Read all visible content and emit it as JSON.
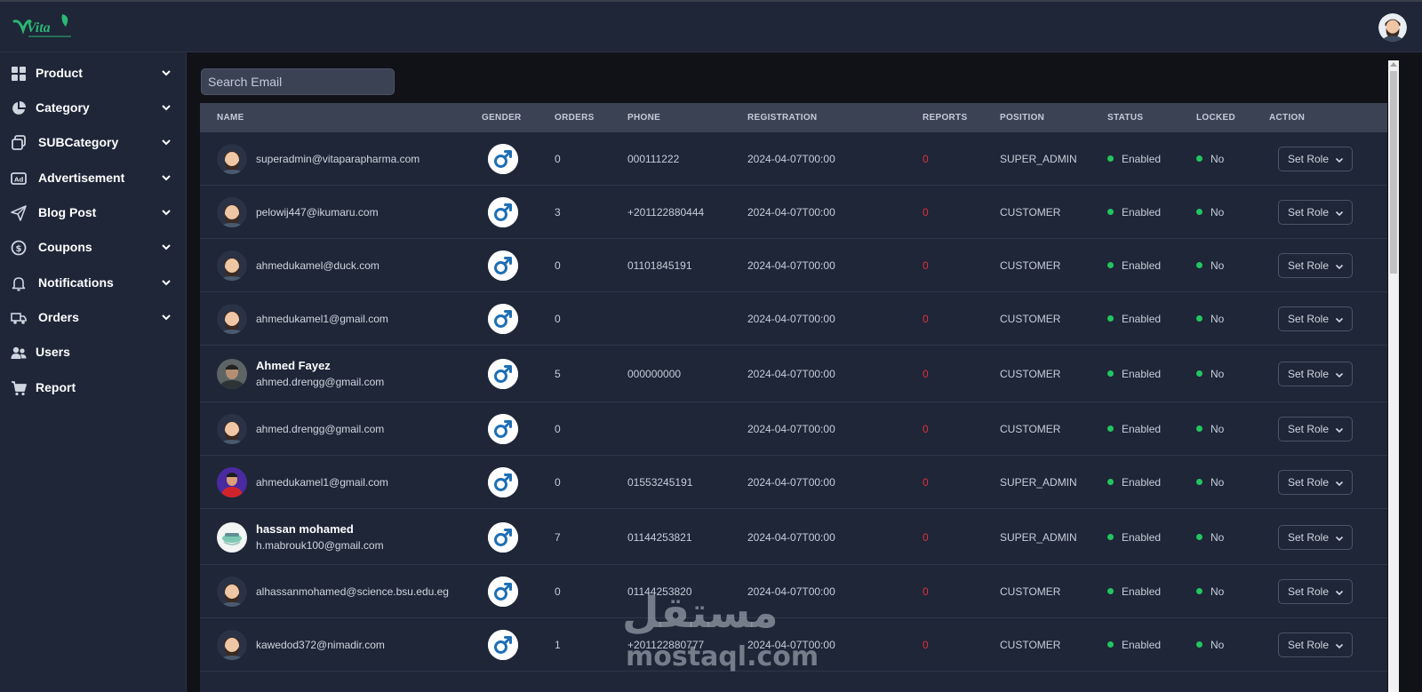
{
  "app": {
    "logo_text": "Vita",
    "accent": "#22c55e",
    "danger": "#e0303a"
  },
  "sidebar": {
    "items": [
      {
        "label": "Product",
        "icon": "grid-icon",
        "has_chevron": true
      },
      {
        "label": "Category",
        "icon": "pie-chart-icon",
        "has_chevron": true
      },
      {
        "label": "SUBCategory",
        "icon": "copy-icon",
        "has_chevron": true
      },
      {
        "label": "Advertisement",
        "icon": "ad-icon",
        "has_chevron": true
      },
      {
        "label": "Blog Post",
        "icon": "send-icon",
        "has_chevron": true
      },
      {
        "label": "Coupons",
        "icon": "dollar-circle-icon",
        "has_chevron": true
      },
      {
        "label": "Notifications",
        "icon": "bell-icon",
        "has_chevron": true
      },
      {
        "label": "Orders",
        "icon": "truck-icon",
        "has_chevron": true
      },
      {
        "label": "Users",
        "icon": "users-icon",
        "has_chevron": false
      },
      {
        "label": "Report",
        "icon": "cart-icon",
        "has_chevron": false
      }
    ]
  },
  "search": {
    "placeholder": "Search Email",
    "value": ""
  },
  "table": {
    "columns": [
      "NAME",
      "GENDER",
      "ORDERS",
      "PHONE",
      "REGISTRATION",
      "REPORTS",
      "POSITION",
      "STATUS",
      "LOCKED",
      "ACTION"
    ],
    "rows": [
      {
        "name": "",
        "email": "superadmin@vitaparapharma.com",
        "gender": "male",
        "orders": "0",
        "phone": "000111222",
        "registration": "2024-04-07T00:00",
        "reports": "0",
        "position": "SUPER_ADMIN",
        "status": "Enabled",
        "locked": "No",
        "action": "Set Role",
        "avatar": "default"
      },
      {
        "name": "",
        "email": "pelowij447@ikumaru.com",
        "gender": "male",
        "orders": "3",
        "phone": "+201122880444",
        "registration": "2024-04-07T00:00",
        "reports": "0",
        "position": "CUSTOMER",
        "status": "Enabled",
        "locked": "No",
        "action": "Set Role",
        "avatar": "default"
      },
      {
        "name": "",
        "email": "ahmedukamel@duck.com",
        "gender": "male",
        "orders": "0",
        "phone": "01101845191",
        "registration": "2024-04-07T00:00",
        "reports": "0",
        "position": "CUSTOMER",
        "status": "Enabled",
        "locked": "No",
        "action": "Set Role",
        "avatar": "default"
      },
      {
        "name": "",
        "email": "ahmedukamel1@gmail.com",
        "gender": "male",
        "orders": "0",
        "phone": "",
        "registration": "2024-04-07T00:00",
        "reports": "0",
        "position": "CUSTOMER",
        "status": "Enabled",
        "locked": "No",
        "action": "Set Role",
        "avatar": "default"
      },
      {
        "name": "Ahmed Fayez",
        "email": "ahmed.drengg@gmail.com",
        "gender": "male",
        "orders": "5",
        "phone": "000000000",
        "registration": "2024-04-07T00:00",
        "reports": "0",
        "position": "CUSTOMER",
        "status": "Enabled",
        "locked": "No",
        "action": "Set Role",
        "avatar": "photo-dark"
      },
      {
        "name": "",
        "email": "ahmed.drengg@gmail.com",
        "gender": "male",
        "orders": "0",
        "phone": "",
        "registration": "2024-04-07T00:00",
        "reports": "0",
        "position": "CUSTOMER",
        "status": "Enabled",
        "locked": "No",
        "action": "Set Role",
        "avatar": "default"
      },
      {
        "name": "",
        "email": "ahmedukamel1@gmail.com",
        "gender": "male",
        "orders": "0",
        "phone": "01553245191",
        "registration": "2024-04-07T00:00",
        "reports": "0",
        "position": "SUPER_ADMIN",
        "status": "Enabled",
        "locked": "No",
        "action": "Set Role",
        "avatar": "photo-red"
      },
      {
        "name": "hassan mohamed",
        "email": "h.mabrouk100@gmail.com",
        "gender": "male",
        "orders": "7",
        "phone": "01144253821",
        "registration": "2024-04-07T00:00",
        "reports": "0",
        "position": "SUPER_ADMIN",
        "status": "Enabled",
        "locked": "No",
        "action": "Set Role",
        "avatar": "photo-light"
      },
      {
        "name": "",
        "email": "alhassanmohamed@science.bsu.edu.eg",
        "gender": "male",
        "orders": "0",
        "phone": "01144253820",
        "registration": "2024-04-07T00:00",
        "reports": "0",
        "position": "CUSTOMER",
        "status": "Enabled",
        "locked": "No",
        "action": "Set Role",
        "avatar": "default"
      },
      {
        "name": "",
        "email": "kawedod372@nimadir.com",
        "gender": "male",
        "orders": "1",
        "phone": "+201122880777",
        "registration": "2024-04-07T00:00",
        "reports": "0",
        "position": "CUSTOMER",
        "status": "Enabled",
        "locked": "No",
        "action": "Set Role",
        "avatar": "default"
      }
    ]
  },
  "watermark": {
    "arabic": "مستقل",
    "latin": "mostaql.com"
  }
}
